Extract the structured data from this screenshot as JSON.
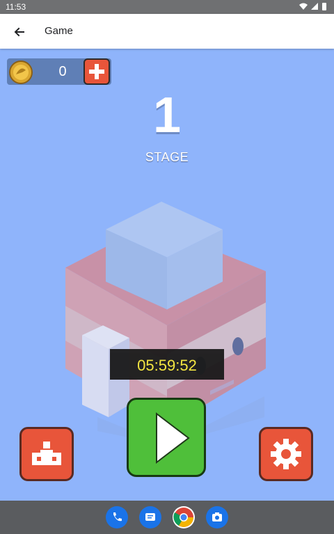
{
  "status_bar": {
    "time": "11:53"
  },
  "app_bar": {
    "title": "Game"
  },
  "hud": {
    "coins": "0"
  },
  "stage": {
    "number": "1",
    "label": "STAGE"
  },
  "timer": {
    "value": "05:59:52"
  },
  "dock": {
    "apps": [
      "phone-icon",
      "messages-icon",
      "chrome-icon",
      "camera-icon"
    ]
  },
  "colors": {
    "background": "#8fb4fb",
    "button_red": "#e8553a",
    "play_green": "#4fbf3a",
    "timer_text": "#f5e83a"
  }
}
